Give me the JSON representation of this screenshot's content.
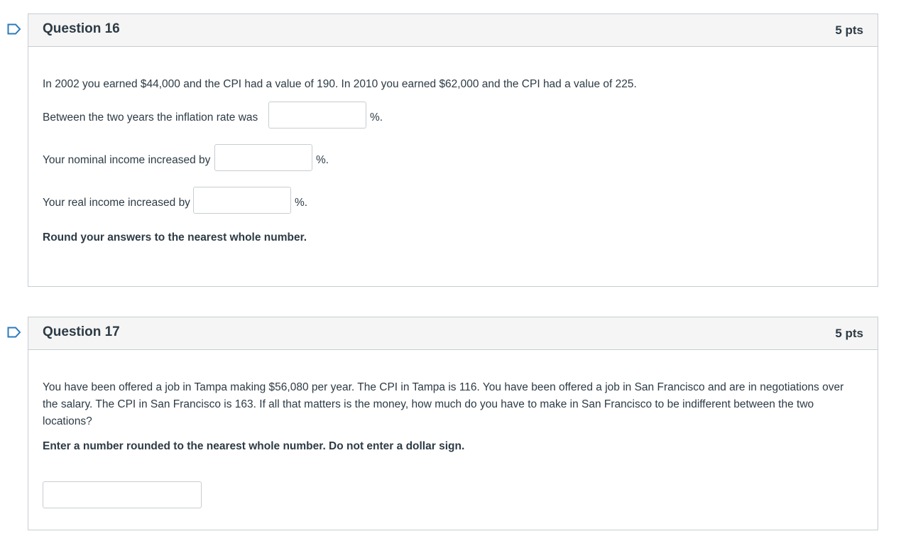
{
  "questions": [
    {
      "title": "Question 16",
      "points": "5 pts",
      "intro": "In 2002 you earned $44,000 and the CPI had a value of 190.  In 2010 you earned $62,000 and the CPI had a value of 225.",
      "prompts": [
        {
          "label": "Between the two years the inflation rate was",
          "value": "",
          "suffix": "%."
        },
        {
          "label": "Your nominal income increased by",
          "value": "",
          "suffix": "%."
        },
        {
          "label": "Your real income increased by",
          "value": "",
          "suffix": "%."
        }
      ],
      "instruction": "Round your answers to the nearest whole number."
    },
    {
      "title": "Question 17",
      "points": "5 pts",
      "intro": "You have been offered a job in Tampa making $56,080 per year. The CPI in Tampa is 116. You have been offered a job in San Francisco and are in negotiations over the salary. The CPI in San Francisco is 163. If all that matters is the money, how much do you have to make in San Francisco to be indifferent between the two locations?",
      "instruction": "Enter a number rounded to the nearest whole number.  Do not enter a dollar sign.",
      "answer": {
        "value": ""
      }
    }
  ],
  "icons": {
    "flag": "flag-outline-icon",
    "flag_color": "#2b7abc"
  }
}
